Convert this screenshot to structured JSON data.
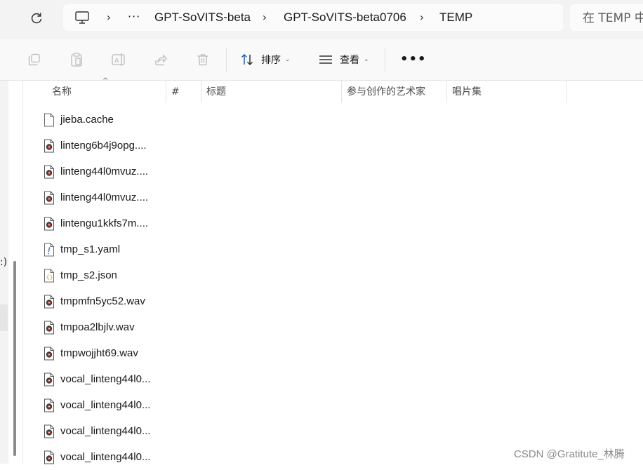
{
  "address": {
    "crumbs": [
      "GPT-SoVITS-beta",
      "GPT-SoVITS-beta0706",
      "TEMP"
    ],
    "more": "···"
  },
  "search": {
    "placeholder": "在 TEMP 中"
  },
  "toolbar": {
    "sort_label": "排序",
    "view_label": "查看",
    "more": "•••"
  },
  "nav": {
    "fragment": ":)"
  },
  "columns": [
    {
      "label": "名称"
    },
    {
      "label": "#"
    },
    {
      "label": "标题"
    },
    {
      "label": "参与创作的艺术家"
    },
    {
      "label": "唱片集"
    }
  ],
  "files": [
    {
      "name": "jieba.cache",
      "icon": "blank-file-icon"
    },
    {
      "name": "linteng6b4j9opg....",
      "icon": "audio-file-icon"
    },
    {
      "name": "linteng44l0mvuz....",
      "icon": "audio-file-icon"
    },
    {
      "name": "linteng44l0mvuz....",
      "icon": "audio-file-icon"
    },
    {
      "name": "lintengu1kkfs7m....",
      "icon": "audio-file-icon"
    },
    {
      "name": "tmp_s1.yaml",
      "icon": "yaml-file-icon"
    },
    {
      "name": "tmp_s2.json",
      "icon": "json-file-icon"
    },
    {
      "name": "tmpmfn5yc52.wav",
      "icon": "audio-file-icon"
    },
    {
      "name": "tmpoa2lbjlv.wav",
      "icon": "audio-file-icon"
    },
    {
      "name": "tmpwojjht69.wav",
      "icon": "audio-file-icon"
    },
    {
      "name": "vocal_linteng44l0...",
      "icon": "audio-file-icon"
    },
    {
      "name": "vocal_linteng44l0...",
      "icon": "audio-file-icon"
    },
    {
      "name": "vocal_linteng44l0...",
      "icon": "audio-file-icon"
    },
    {
      "name": "vocal_linteng44l0...",
      "icon": "audio-file-icon"
    }
  ],
  "watermark": "CSDN @Gratitute_林腾",
  "colors": {
    "accent": "#1a5fb4",
    "toolbar_bg": "#f9f9f9",
    "addr_bg": "#f3f3f3"
  }
}
